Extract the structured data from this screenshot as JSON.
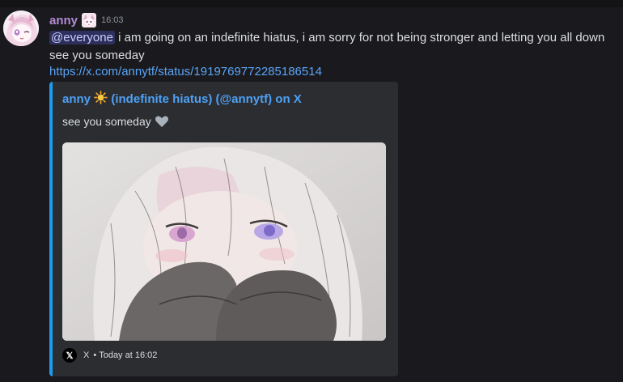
{
  "message": {
    "username": "anny",
    "time": "16:03",
    "mention": "@everyone",
    "text": " i am going on an indefinite hiatus, i am sorry for not being stronger and letting you all down",
    "text2": "see you someday",
    "link": "https://x.com/annytf/status/1919769772285186514"
  },
  "embed": {
    "author_name": "anny",
    "author_rest": " (indefinite hiatus) (@annytf) on X",
    "description": "see you someday",
    "footer_source": "X",
    "footer_sep": "•",
    "footer_time": "Today at 16:02",
    "accent_color": "#1d9bf0"
  },
  "icons": {
    "sun": "sun-emoji-icon",
    "heart": "grey-heart-emoji-icon",
    "x_logo": "x-logo-icon"
  }
}
